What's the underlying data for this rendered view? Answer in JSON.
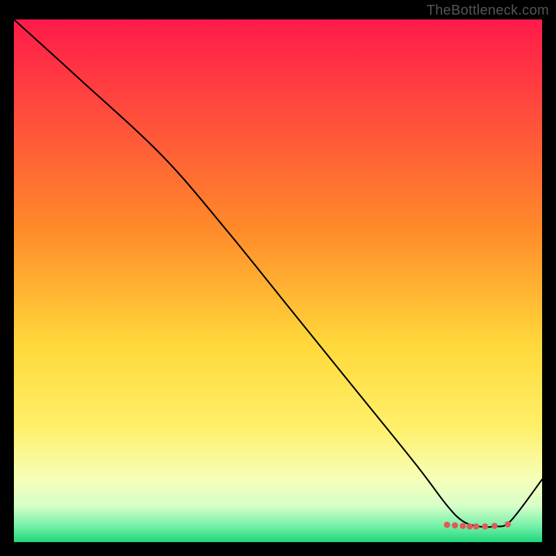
{
  "watermark": "TheBottleneck.com",
  "chart_data": {
    "type": "line",
    "title": "",
    "xlabel": "",
    "ylabel": "",
    "xlim": [
      0,
      100
    ],
    "ylim": [
      0,
      100
    ],
    "background_gradient": {
      "stops": [
        {
          "offset": 0,
          "color": "#ff1a4a"
        },
        {
          "offset": 40,
          "color": "#ff8a2a"
        },
        {
          "offset": 62,
          "color": "#ffd83a"
        },
        {
          "offset": 78,
          "color": "#fff06a"
        },
        {
          "offset": 88,
          "color": "#f6ffb8"
        },
        {
          "offset": 93,
          "color": "#d8ffc8"
        },
        {
          "offset": 97,
          "color": "#73f0a8"
        },
        {
          "offset": 100,
          "color": "#1ed67a"
        }
      ]
    },
    "series": [
      {
        "name": "bottleneck-curve",
        "stroke": "#000000",
        "stroke_width": 2.2,
        "x": [
          0,
          12,
          28,
          40,
          52,
          64,
          76,
          82,
          85,
          88,
          91,
          94,
          100
        ],
        "y": [
          100,
          89,
          74,
          60,
          45,
          30,
          15,
          7,
          4,
          3,
          3,
          4,
          12
        ]
      }
    ],
    "markers": {
      "name": "optimal-dots",
      "color": "#e05a5a",
      "radius": 4.5,
      "points": [
        {
          "x": 82.0,
          "y": 3.3
        },
        {
          "x": 83.5,
          "y": 3.2
        },
        {
          "x": 85.0,
          "y": 3.1
        },
        {
          "x": 86.3,
          "y": 3.0
        },
        {
          "x": 87.5,
          "y": 3.0
        },
        {
          "x": 89.2,
          "y": 3.0
        },
        {
          "x": 91.0,
          "y": 3.1
        },
        {
          "x": 93.5,
          "y": 3.4
        }
      ]
    }
  }
}
